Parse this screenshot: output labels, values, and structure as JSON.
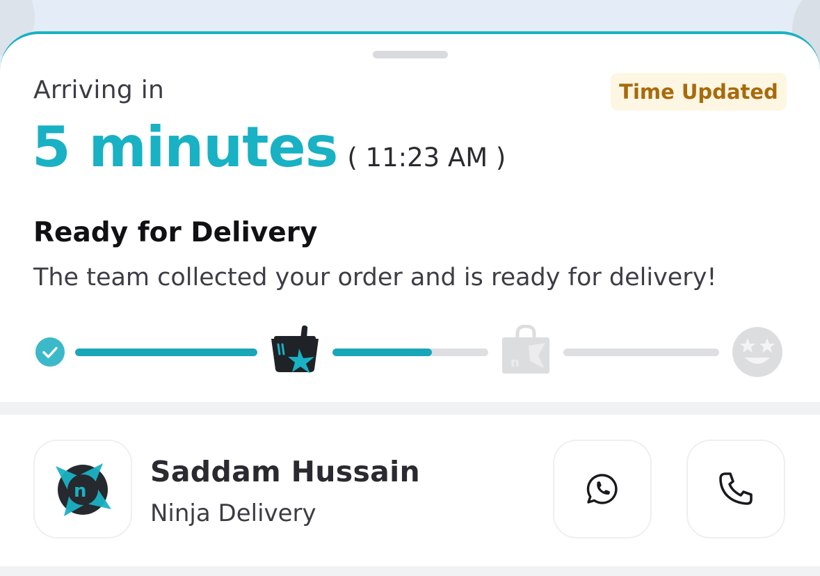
{
  "eta": {
    "label": "Arriving in",
    "duration": "5 minutes",
    "clock_time": "( 11:23 AM )",
    "badge": "Time Updated"
  },
  "status": {
    "title": "Ready for Delivery",
    "description": "The team collected your order and is ready for delivery!"
  },
  "progress": {
    "steps": [
      {
        "icon": "check-circle-icon",
        "state": "done"
      },
      {
        "icon": "ninja-basket-icon",
        "state": "current"
      },
      {
        "icon": "shopping-bag-icon",
        "state": "pending"
      },
      {
        "icon": "star-eyes-face-icon",
        "state": "pending"
      }
    ],
    "segments": [
      1.0,
      0.64,
      0.0
    ]
  },
  "rider": {
    "name": "Saddam Hussain",
    "company": "Ninja Delivery",
    "actions": [
      {
        "icon": "whatsapp-icon"
      },
      {
        "icon": "phone-icon"
      }
    ]
  },
  "colors": {
    "accent": "#19b1c4",
    "badge_bg": "#fdf6e2",
    "badge_text": "#a86a0c",
    "inactive": "#dedfe2"
  }
}
